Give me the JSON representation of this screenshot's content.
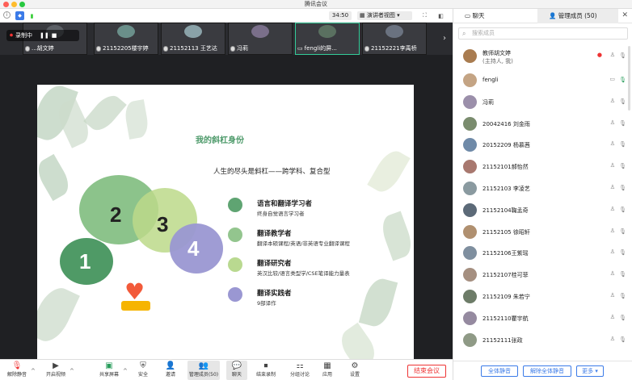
{
  "app": {
    "title": "腾讯会议"
  },
  "topbar": {
    "timer": "34:50",
    "view_mode": "演讲者视图"
  },
  "recording": {
    "label": "录制中"
  },
  "thumbs": [
    {
      "name": "教师胡文婷",
      "label": "...胡文婷"
    },
    {
      "name": "21152205楼宇婷",
      "label": "21152205楼宇婷"
    },
    {
      "name": "21152113王艺达",
      "label": "21152113 王艺达"
    },
    {
      "name": "冯莉",
      "label": "冯莉"
    },
    {
      "name": "fengli的屏幕",
      "label": "fengli的屏..."
    },
    {
      "name": "21152221李禹桥",
      "label": "21152221李禹桥"
    }
  ],
  "slide": {
    "title": "我的斜杠身份",
    "subtitle": "人生的尽头是斜杠——跨学科、复合型",
    "numbers": [
      "1",
      "2",
      "3",
      "4"
    ],
    "items": [
      {
        "heading": "语言和翻译学习者",
        "desc": "终身自觉语言学习者"
      },
      {
        "heading": "翻译教学者",
        "desc": "翻译本硕课程/英语/非英语专业翻译课程"
      },
      {
        "heading": "翻译研究者",
        "desc": "英汉比较/语言类型学/CSE笔译能力量表"
      },
      {
        "heading": "翻译实践者",
        "desc": "9部译作"
      }
    ]
  },
  "toolbar": {
    "buttons": [
      {
        "label": "解除静音",
        "icon": "mic-muted-icon"
      },
      {
        "label": "开启视频",
        "icon": "camera-off-icon"
      },
      {
        "label": "共享屏幕",
        "icon": "share-screen-icon"
      },
      {
        "label": "安全",
        "icon": "shield-icon"
      },
      {
        "label": "邀请",
        "icon": "invite-icon"
      },
      {
        "label": "管理成员(50)",
        "icon": "members-icon"
      },
      {
        "label": "聊天",
        "icon": "chat-icon"
      },
      {
        "label": "结束录制",
        "icon": "stop-record-icon"
      },
      {
        "label": "分组讨论",
        "icon": "breakout-icon"
      },
      {
        "label": "应用",
        "icon": "apps-icon"
      },
      {
        "label": "设置",
        "icon": "gear-icon"
      }
    ],
    "end_label": "结束会议"
  },
  "panel": {
    "tab_chat": "聊天",
    "tab_members": "管理成员 (50)",
    "search_placeholder": "搜索成员",
    "host_name": "教师胡文婷",
    "host_role": "(主持人, 我)",
    "members": [
      "fengli",
      "冯莉",
      "20042416 刘金雨",
      "20152209 杨慕茜",
      "21152101郝怡然",
      "21152103 李凌艺",
      "21152104鞠孟奇",
      "21152105 徐昭轩",
      "21152106王紫瑶",
      "21152107桂可菲",
      "21152109 朱若宁",
      "21152110瞿宇航",
      "21152111张政"
    ],
    "btn_mute_all": "全体静音",
    "btn_unmute_all": "解除全体静音",
    "btn_more": "更多"
  },
  "colors": {
    "accent": "#3b7be8",
    "slide_green": "#4d9a6a",
    "end_red": "#e33333"
  }
}
